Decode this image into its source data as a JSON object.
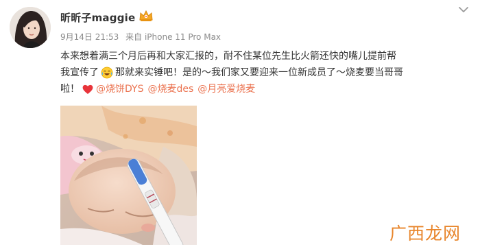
{
  "post": {
    "author": {
      "name": "昕昕子maggie",
      "badge_icon": "vip-crown-icon"
    },
    "meta": {
      "date": "9月14日 21:53",
      "source": "来自 iPhone 11 Pro Max"
    },
    "content": {
      "line1": "本来想着满三个月后再和大家汇报的，耐不住某位先生比火箭还快的嘴儿提前帮",
      "line2_before": "我宣传了",
      "line2_emoji": "crying-laughing-emoji",
      "line2_after": "那就来实锤吧！是的～我们家又要迎来一位新成员了～烧麦要当哥哥",
      "line3_before": "啦！",
      "line3_emoji": "red-heart-emoji",
      "mentions": [
        "@烧饼DYS",
        "@烧麦des",
        "@月亮爱烧麦"
      ]
    },
    "photo": {
      "subject": "baby-and-pregnancy-test-photo"
    },
    "more_icon": "chevron-down-icon"
  },
  "watermark": {
    "text": "广西龙网"
  },
  "colors": {
    "mention": "#eb7350",
    "meta": "#8a8a8a",
    "watermark": "#e8852b"
  }
}
